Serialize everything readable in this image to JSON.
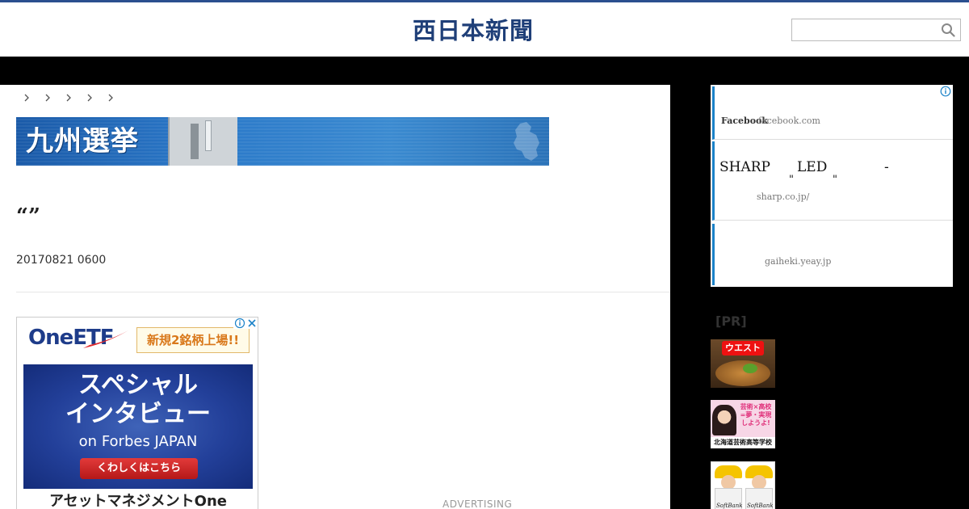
{
  "header": {
    "logo_text": "西日本新聞",
    "search": {
      "placeholder": "",
      "value": "",
      "icon": "search-icon"
    },
    "accent_color": "#2b4f8f"
  },
  "breadcrumb": {
    "items": [
      "",
      "",
      "",
      "",
      ""
    ],
    "separator_icon": "chevron-right-icon"
  },
  "banner": {
    "title": "九州選挙",
    "background": "#2a78c8"
  },
  "article": {
    "headline": "“”",
    "date": "20170821 0600"
  },
  "main_ad": {
    "logo": "OneETF",
    "badge": "新規2銘柄上場!!",
    "line1": "スペシャル",
    "line2": "インタビュー",
    "line3": "on Forbes JAPAN",
    "cta": "くわしくはこちら",
    "footer": "アセットマネジメントOne",
    "advertising_label": "ADVERTISING"
  },
  "side_ad": {
    "row1": {
      "brand": "Facebook",
      "url": "facebook.com"
    },
    "row2": {
      "title": "SHARP",
      "led": "LED",
      "dash": "-",
      "quote_open": "\"",
      "quote_close": "\"",
      "url": "sharp.co.jp/"
    },
    "row3": {
      "url": "gaiheki.yeay.jp"
    },
    "accent_color": "#1b82c8"
  },
  "pr": {
    "label": "[PR]",
    "items": [
      {
        "tag": "ウエスト"
      },
      {
        "text": "芸術×高校=夢・実現しようよ!",
        "caption": "北海道芸術高等学校"
      },
      {
        "logo_left": "SoftBank",
        "logo_right": "SoftBank"
      }
    ]
  }
}
